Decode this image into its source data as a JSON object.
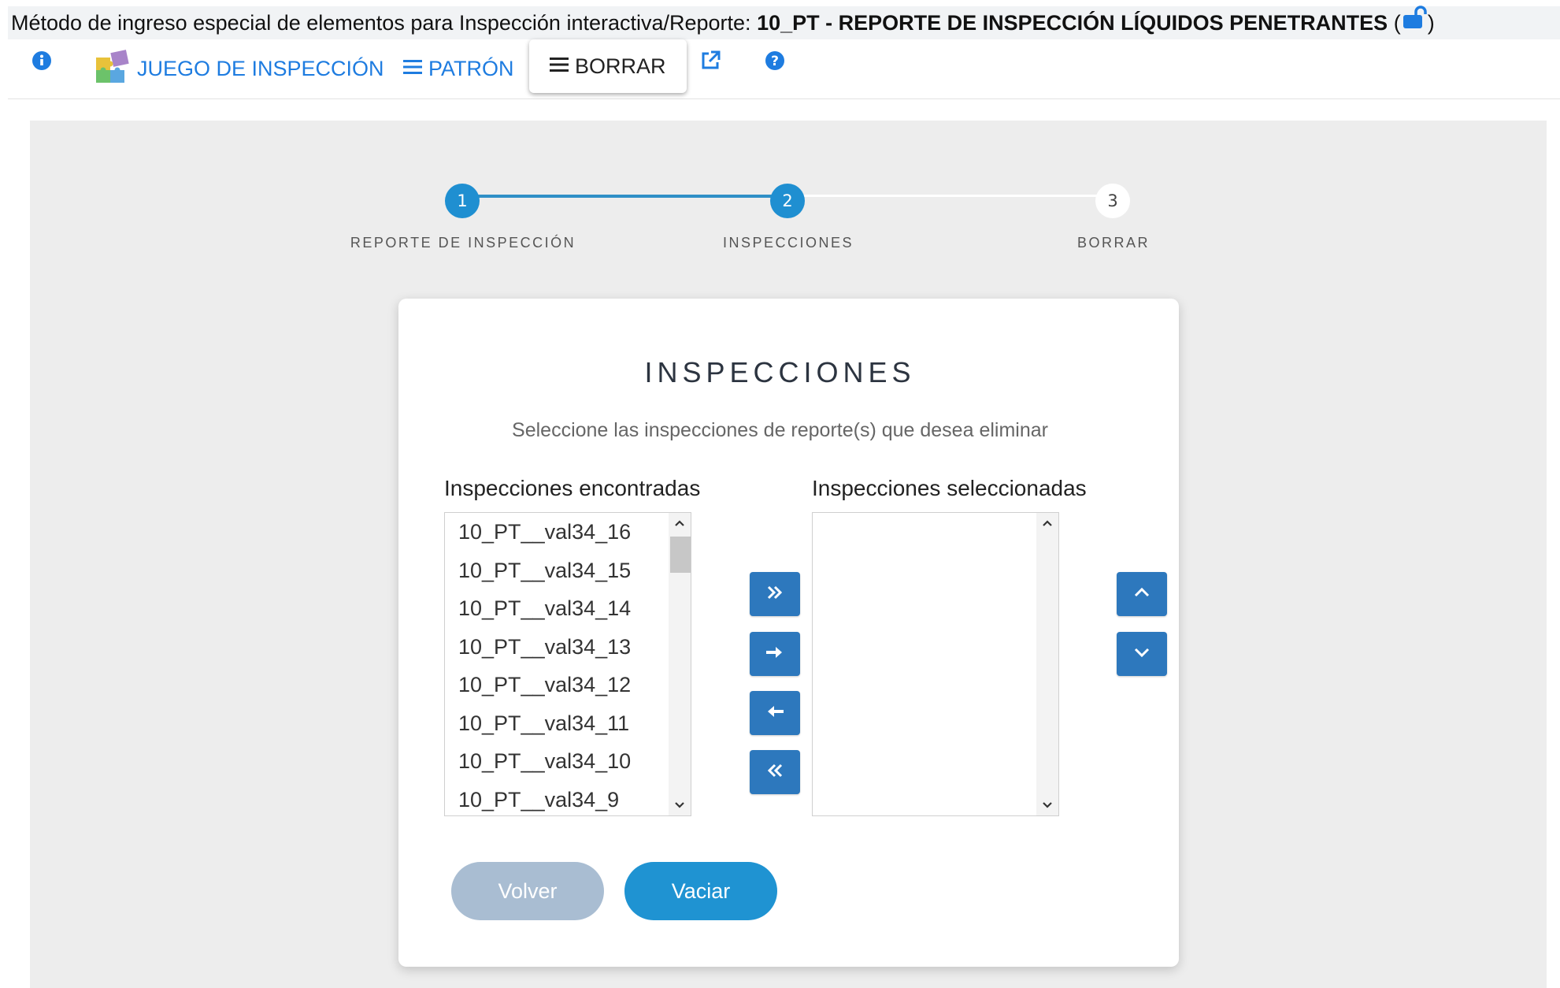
{
  "title": {
    "prefix": "Método de ingreso especial de elementos para Inspección interactiva/Reporte: ",
    "report": "10_PT - REPORTE DE INSPECCIÓN LÍQUIDOS PENETRANTES",
    "open_paren": " (",
    "close_paren": ")"
  },
  "toolbar": {
    "juego_label": "JUEGO DE INSPECCIÓN",
    "patron_label": "PATRÓN",
    "borrar_label": "BORRAR"
  },
  "stepper": {
    "steps": [
      {
        "number": "1",
        "label": "REPORTE DE INSPECCIÓN",
        "state": "done"
      },
      {
        "number": "2",
        "label": "INSPECCIONES",
        "state": "done"
      },
      {
        "number": "3",
        "label": "BORRAR",
        "state": "pending"
      }
    ]
  },
  "card": {
    "title": "INSPECCIONES",
    "subtitle": "Seleccione las inspecciones de reporte(s) que desea eliminar",
    "found_header": "Inspecciones encontradas",
    "selected_header": "Inspecciones seleccionadas",
    "found_items": [
      "10_PT__val34_16",
      "10_PT__val34_15",
      "10_PT__val34_14",
      "10_PT__val34_13",
      "10_PT__val34_12",
      "10_PT__val34_11",
      "10_PT__val34_10",
      "10_PT__val34_9"
    ],
    "selected_items": [],
    "back_label": "Volver",
    "empty_label": "Vaciar"
  },
  "colors": {
    "accent": "#1f8fd1",
    "link": "#1e7ce0",
    "button": "#2d78bd",
    "back_button": "#a9bdd2"
  },
  "icons": {
    "info": "info-icon",
    "puzzle": "puzzle-icon",
    "menu": "hamburger-icon",
    "external": "external-link-icon",
    "help": "help-icon",
    "lock": "unlock-icon"
  }
}
